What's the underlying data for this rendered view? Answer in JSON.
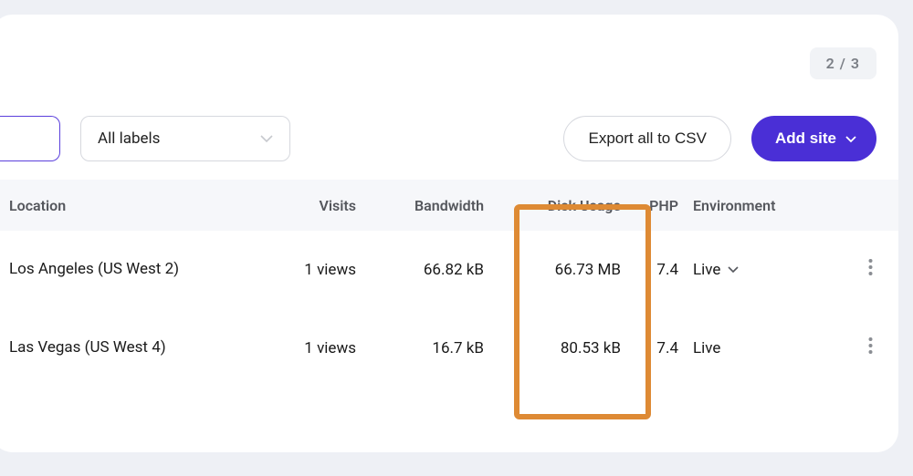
{
  "pagination": "2 / 3",
  "actions": {
    "labels_dropdown": "All labels",
    "export_btn": "Export all to CSV",
    "add_btn": "Add site"
  },
  "table": {
    "headers": {
      "location": "Location",
      "visits": "Visits",
      "bandwidth": "Bandwidth",
      "disk": "Disk Usage",
      "php": "PHP",
      "env": "Environment"
    },
    "rows": [
      {
        "location": "Los Angeles (US West 2)",
        "visits": "1 views",
        "bandwidth": "66.82 kB",
        "disk": "66.73 MB",
        "php": "7.4",
        "env": "Live",
        "env_expandable": true
      },
      {
        "location": "Las Vegas (US West 4)",
        "visits": "1 views",
        "bandwidth": "16.7 kB",
        "disk": "80.53 kB",
        "php": "7.4",
        "env": "Live",
        "env_expandable": false
      }
    ]
  }
}
